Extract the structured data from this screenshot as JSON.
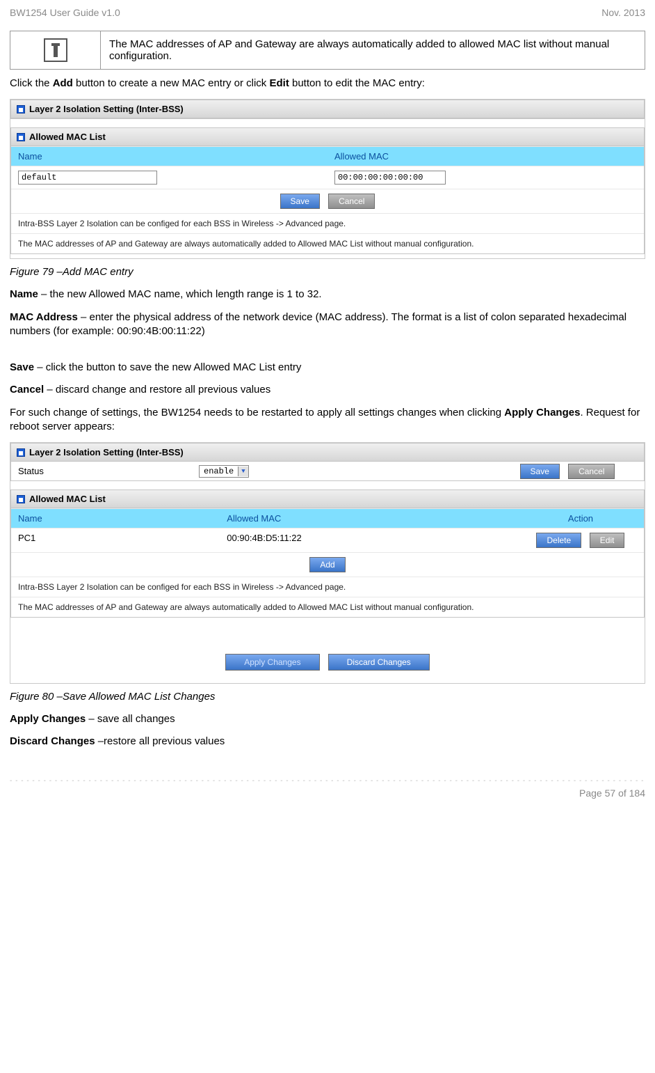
{
  "header": {
    "left": "BW1254 User Guide v1.0",
    "right": "Nov.  2013"
  },
  "info_box": {
    "text": "The MAC addresses of AP and Gateway are always automatically added to allowed MAC list without manual configuration."
  },
  "para_click_add": {
    "pre": "Click the ",
    "b1": "Add",
    "mid": " button to create a new MAC entry or click ",
    "b2": "Edit",
    "post": " button to edit the MAC entry:"
  },
  "fig1": {
    "panel1_title": "Layer 2 Isolation Setting (Inter-BSS)",
    "panel2_title": "Allowed MAC List",
    "col_name": "Name",
    "col_mac": "Allowed MAC",
    "name_val": "default",
    "mac_val": "00:00:00:00:00:00",
    "save_btn": "Save",
    "cancel_btn": "Cancel",
    "note1": "Intra-BSS Layer 2 Isolation can be configed for each BSS in Wireless -> Advanced page.",
    "note2": "The MAC addresses of AP and Gateway are always automatically added to Allowed MAC List without manual configuration."
  },
  "caption1": "Figure 79 –Add MAC entry",
  "para_name": {
    "b": "Name",
    "rest": " – the new Allowed MAC name, which length range is 1 to 32."
  },
  "para_mac": {
    "b": "MAC Address",
    "rest": " – enter the physical address of the network device (MAC address). The format is a list of colon separated hexadecimal numbers (for example: 00:90:4B:00:11:22)"
  },
  "para_save": {
    "b": "Save",
    "rest": " – click the button to save the new Allowed MAC List entry"
  },
  "para_cancel": {
    "b": "Cancel",
    "rest": " – discard change and restore all previous values"
  },
  "para_restart": {
    "pre": "For such change of settings, the BW1254 needs to be restarted to apply all settings changes when clicking ",
    "b": "Apply Changes",
    "post": ". Request for reboot server appears:"
  },
  "fig2": {
    "panel1_title": "Layer 2 Isolation Setting (Inter-BSS)",
    "status_label": "Status",
    "status_value": "enable",
    "save_btn": "Save",
    "cancel_btn": "Cancel",
    "panel2_title": "Allowed MAC List",
    "col_name": "Name",
    "col_mac": "Allowed MAC",
    "col_action": "Action",
    "row_name": "PC1",
    "row_mac": "00:90:4B:D5:11:22",
    "delete_btn": "Delete",
    "edit_btn": "Edit",
    "add_btn": "Add",
    "note1": "Intra-BSS Layer 2 Isolation can be configed for each BSS in Wireless -> Advanced page.",
    "note2": "The MAC addresses of AP and Gateway are always automatically added to Allowed MAC List without manual configuration.",
    "apply_btn": "Apply Changes",
    "discard_btn": "Discard Changes"
  },
  "caption2": "Figure 80 –Save Allowed MAC List Changes",
  "para_apply": {
    "b": "Apply Changes",
    "rest": " – save all changes"
  },
  "para_discard": {
    "b": "Discard Changes",
    "rest": " –restore all previous values"
  },
  "footer": {
    "page": "Page 57 of 184"
  }
}
